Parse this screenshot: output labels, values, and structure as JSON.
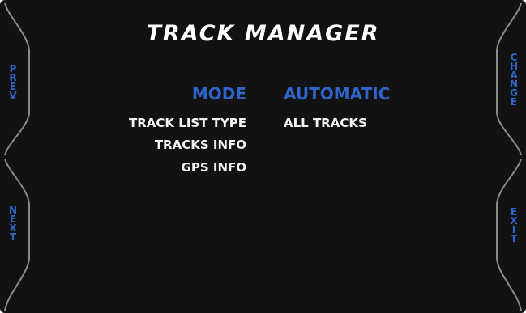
{
  "title": "TRACK MANAGER",
  "softkeys": {
    "prev": [
      "P",
      "R",
      "E",
      "V"
    ],
    "next": [
      "N",
      "E",
      "X",
      "T"
    ],
    "change": [
      "C",
      "H",
      "A",
      "N",
      "G",
      "E"
    ],
    "exit": [
      "E",
      "X",
      "I",
      "T"
    ]
  },
  "rows": [
    {
      "label": "MODE",
      "value": "AUTOMATIC"
    },
    {
      "label": "TRACK LIST TYPE",
      "value": "ALL TRACKS"
    },
    {
      "label": "TRACKS INFO",
      "value": ""
    },
    {
      "label": "GPS INFO",
      "value": ""
    }
  ],
  "colors": {
    "background": "#121212",
    "accent": "#2f64c8",
    "text": "#f2f2f2",
    "frame": "#8a8a8a"
  }
}
